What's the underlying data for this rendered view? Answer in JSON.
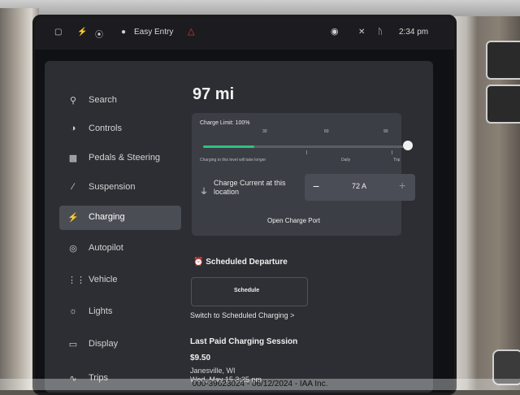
{
  "status_bar": {
    "profile_name": "Easy Entry",
    "time": "2:34 pm",
    "icons": [
      "door-icon",
      "lightning-icon",
      "tire-pressure-icon",
      "person-icon",
      "warning-icon",
      "circle-icon",
      "signal-off-icon",
      "bluetooth-icon"
    ]
  },
  "sidebar": {
    "items": [
      {
        "label": "Search",
        "icon": "search-icon"
      },
      {
        "label": "Controls",
        "icon": "toggle-icon"
      },
      {
        "label": "Pedals & Steering",
        "icon": "car-icon"
      },
      {
        "label": "Suspension",
        "icon": "suspension-icon"
      },
      {
        "label": "Charging",
        "icon": "lightning-icon",
        "active": true
      },
      {
        "label": "Autopilot",
        "icon": "steering-wheel-icon"
      },
      {
        "label": "Vehicle",
        "icon": "sliders-icon"
      },
      {
        "label": "Lights",
        "icon": "sun-icon"
      },
      {
        "label": "Display",
        "icon": "display-icon"
      },
      {
        "label": "Trips",
        "icon": "trips-icon"
      }
    ]
  },
  "charging": {
    "range": "97 mi",
    "charge_limit_label": "Charge Limit: 100%",
    "charge_limit_percent": 100,
    "ticks": [
      "30",
      "60",
      "90"
    ],
    "warning_text": "Charging to this level will take longer",
    "daily_label": "Daily",
    "trip_label": "Trip",
    "charge_current_label": "Charge Current at this location",
    "charge_current_value": "72 A",
    "minus_symbol": "−",
    "plus_symbol": "+",
    "open_charge_port": "Open Charge Port"
  },
  "scheduled": {
    "title": "Scheduled Departure",
    "schedule_button": "Schedule",
    "switch_link": "Switch to Scheduled Charging >"
  },
  "last_session": {
    "title": "Last Paid Charging Session",
    "price": "$9.50",
    "location": "Janesville, WI",
    "date": "Wed, May 15 3:25 pm"
  },
  "watermark": "000-39623024 - 06/12/2024 - IAA Inc.",
  "colors": {
    "accent_green": "#2ec27e",
    "warning_red": "#e03b3b",
    "panel": "#2c2e33"
  }
}
